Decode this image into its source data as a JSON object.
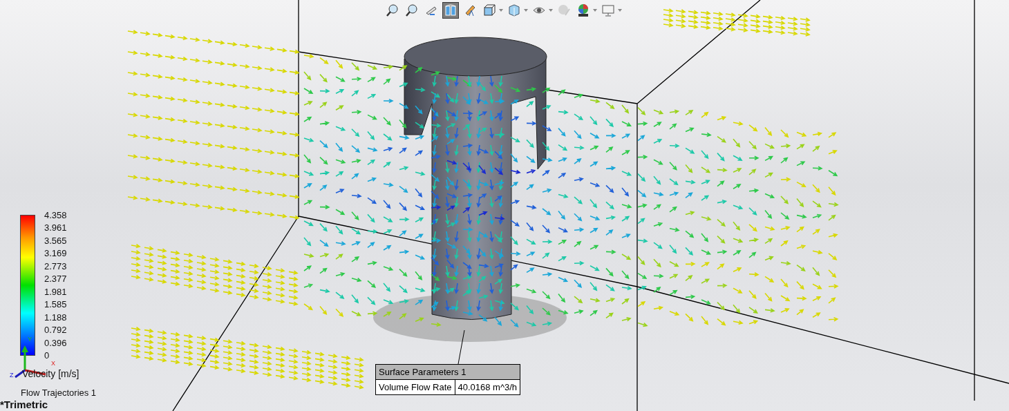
{
  "toolbar": [
    {
      "kind": "zoom-fit",
      "selected": false,
      "dropdown": false
    },
    {
      "kind": "zoom-area",
      "selected": false,
      "dropdown": false
    },
    {
      "kind": "previous-view",
      "selected": false,
      "dropdown": false
    },
    {
      "kind": "section",
      "selected": true,
      "dropdown": false
    },
    {
      "kind": "annotation",
      "selected": false,
      "dropdown": false
    },
    {
      "kind": "orientation",
      "selected": false,
      "dropdown": true
    },
    {
      "kind": "display-style",
      "selected": false,
      "dropdown": true
    },
    {
      "kind": "hide-show",
      "selected": false,
      "dropdown": true
    },
    {
      "kind": "appearance",
      "selected": false,
      "dropdown": false
    },
    {
      "kind": "scene",
      "selected": false,
      "dropdown": true
    },
    {
      "kind": "monitor",
      "selected": false,
      "dropdown": true
    }
  ],
  "legend": {
    "ticks": [
      "4.358",
      "3.961",
      "3.565",
      "3.169",
      "2.773",
      "2.377",
      "1.981",
      "1.585",
      "1.188",
      "0.792",
      "0.396",
      "0"
    ],
    "title": "Velocity [m/s]"
  },
  "triad": {
    "x": "X",
    "y": "Y",
    "z": "Z"
  },
  "plot_label": "Flow Trajectories 1",
  "view_name": "*Trimetric",
  "callout": {
    "title": "Surface Parameters 1",
    "rows": [
      {
        "parameter": "Volume Flow Rate",
        "value": "40.0168 m^3/h"
      }
    ]
  }
}
